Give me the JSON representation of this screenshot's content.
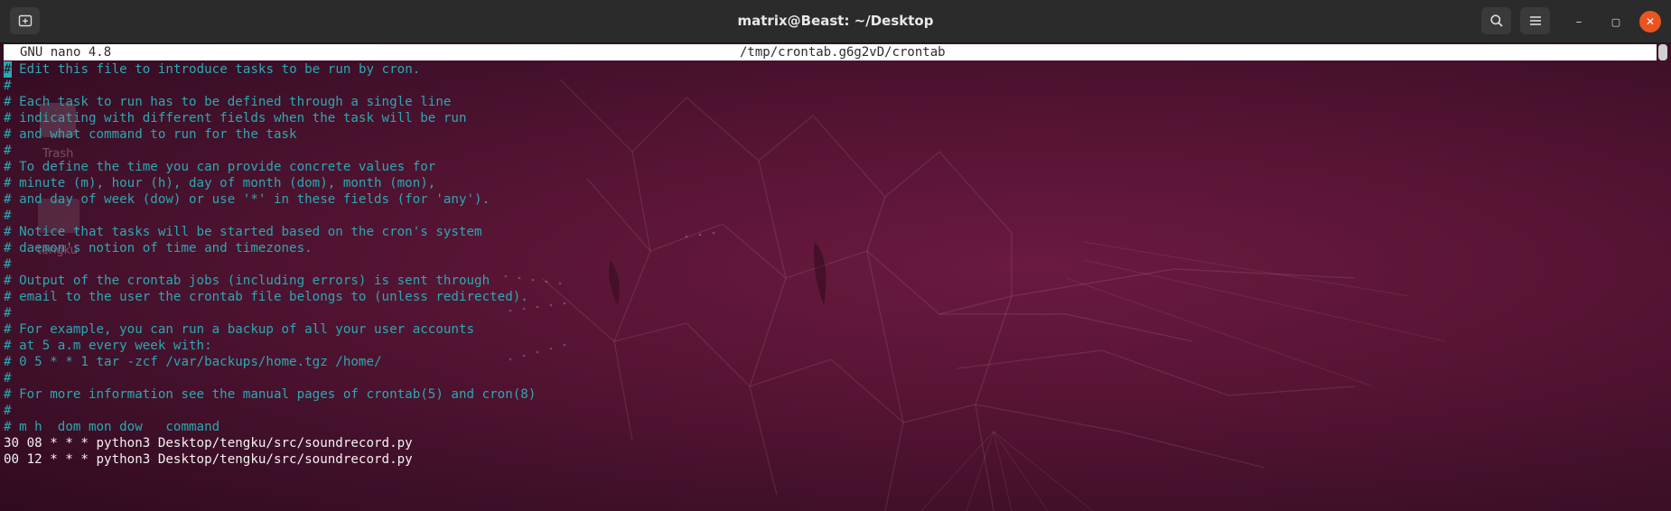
{
  "window": {
    "title": "matrix@Beast: ~/Desktop",
    "new_tab_icon": "new-tab-icon",
    "search_icon": "search-icon",
    "menu_icon": "hamburger-menu-icon",
    "minimize_label": "–",
    "maximize_label": "▢",
    "close_label": "✕"
  },
  "desktop_icons": [
    {
      "label": "Trash"
    },
    {
      "label": "tengku"
    }
  ],
  "nano": {
    "version": "GNU nano 4.8",
    "filename": "/tmp/crontab.g6g2vD/crontab"
  },
  "lines": [
    {
      "text": "# Edit this file to introduce tasks to be run by cron.",
      "kind": "comment"
    },
    {
      "text": "#",
      "kind": "comment"
    },
    {
      "text": "# Each task to run has to be defined through a single line",
      "kind": "comment"
    },
    {
      "text": "# indicating with different fields when the task will be run",
      "kind": "comment"
    },
    {
      "text": "# and what command to run for the task",
      "kind": "comment"
    },
    {
      "text": "#",
      "kind": "comment"
    },
    {
      "text": "# To define the time you can provide concrete values for",
      "kind": "comment"
    },
    {
      "text": "# minute (m), hour (h), day of month (dom), month (mon),",
      "kind": "comment"
    },
    {
      "text": "# and day of week (dow) or use '*' in these fields (for 'any').",
      "kind": "comment"
    },
    {
      "text": "#",
      "kind": "comment"
    },
    {
      "text": "# Notice that tasks will be started based on the cron's system",
      "kind": "comment"
    },
    {
      "text": "# daemon's notion of time and timezones.",
      "kind": "comment"
    },
    {
      "text": "#",
      "kind": "comment"
    },
    {
      "text": "# Output of the crontab jobs (including errors) is sent through",
      "kind": "comment"
    },
    {
      "text": "# email to the user the crontab file belongs to (unless redirected).",
      "kind": "comment"
    },
    {
      "text": "#",
      "kind": "comment"
    },
    {
      "text": "# For example, you can run a backup of all your user accounts",
      "kind": "comment"
    },
    {
      "text": "# at 5 a.m every week with:",
      "kind": "comment"
    },
    {
      "text": "# 0 5 * * 1 tar -zcf /var/backups/home.tgz /home/",
      "kind": "comment"
    },
    {
      "text": "#",
      "kind": "comment"
    },
    {
      "text": "# For more information see the manual pages of crontab(5) and cron(8)",
      "kind": "comment"
    },
    {
      "text": "#",
      "kind": "comment"
    },
    {
      "text": "# m h  dom mon dow   command",
      "kind": "comment"
    },
    {
      "text": "30 08 * * * python3 Desktop/tengku/src/soundrecord.py",
      "kind": "entry"
    },
    {
      "text": "00 12 * * * python3 Desktop/tengku/src/soundrecord.py",
      "kind": "entry"
    }
  ],
  "colors": {
    "comment": "#2aa9b3",
    "entry": "#f2f2f2",
    "background": "#581434",
    "close_button": "#e95420"
  }
}
